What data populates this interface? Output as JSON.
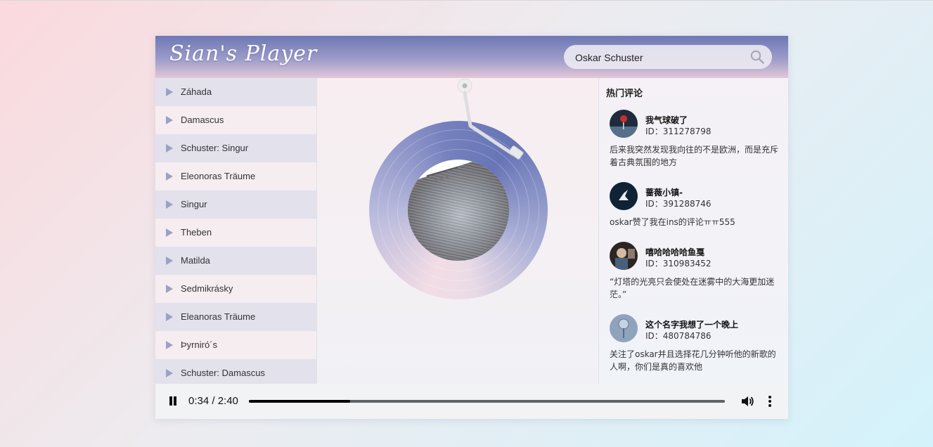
{
  "app": {
    "title": "Sian's Player"
  },
  "search": {
    "value": "Oskar Schuster",
    "icon": "search-icon"
  },
  "playlist": {
    "items": [
      {
        "label": "Záhada"
      },
      {
        "label": "Damascus"
      },
      {
        "label": "Schuster: Singur"
      },
      {
        "label": "Eleonoras Träume"
      },
      {
        "label": "Singur"
      },
      {
        "label": "Theben"
      },
      {
        "label": "Matilda"
      },
      {
        "label": "Sedmikrásky"
      },
      {
        "label": "Eleanoras Träume"
      },
      {
        "label": "Þyrniró´s"
      },
      {
        "label": "Schuster: Damascus"
      }
    ]
  },
  "comments": {
    "title": "热门评论",
    "items": [
      {
        "name": "我气球破了",
        "id": "ID：311278798",
        "text": "后来我突然发现我向往的不是欧洲，而是充斥着古典氛围的地方"
      },
      {
        "name": "蔷薇小镇-",
        "id": "ID：391288746",
        "text": "oskar赞了我在ins的评论ㅠㅠ555"
      },
      {
        "name": "嘻哈哈哈哈鱼戛",
        "id": "ID：310983452",
        "text": "“灯塔的光亮只会使处在迷雾中的大海更加迷茫。”"
      },
      {
        "name": "这个名字我想了一个晚上",
        "id": "ID：480784786",
        "text": "关注了oskar并且选择花几分钟听他的新歌的人啊，你们是真的喜欢他"
      }
    ]
  },
  "audio": {
    "time": "0:34 / 2:40",
    "progress_fraction": 0.2125
  },
  "colors": {
    "accent": "#6775b6",
    "play_icon": "#9fa0c6"
  }
}
